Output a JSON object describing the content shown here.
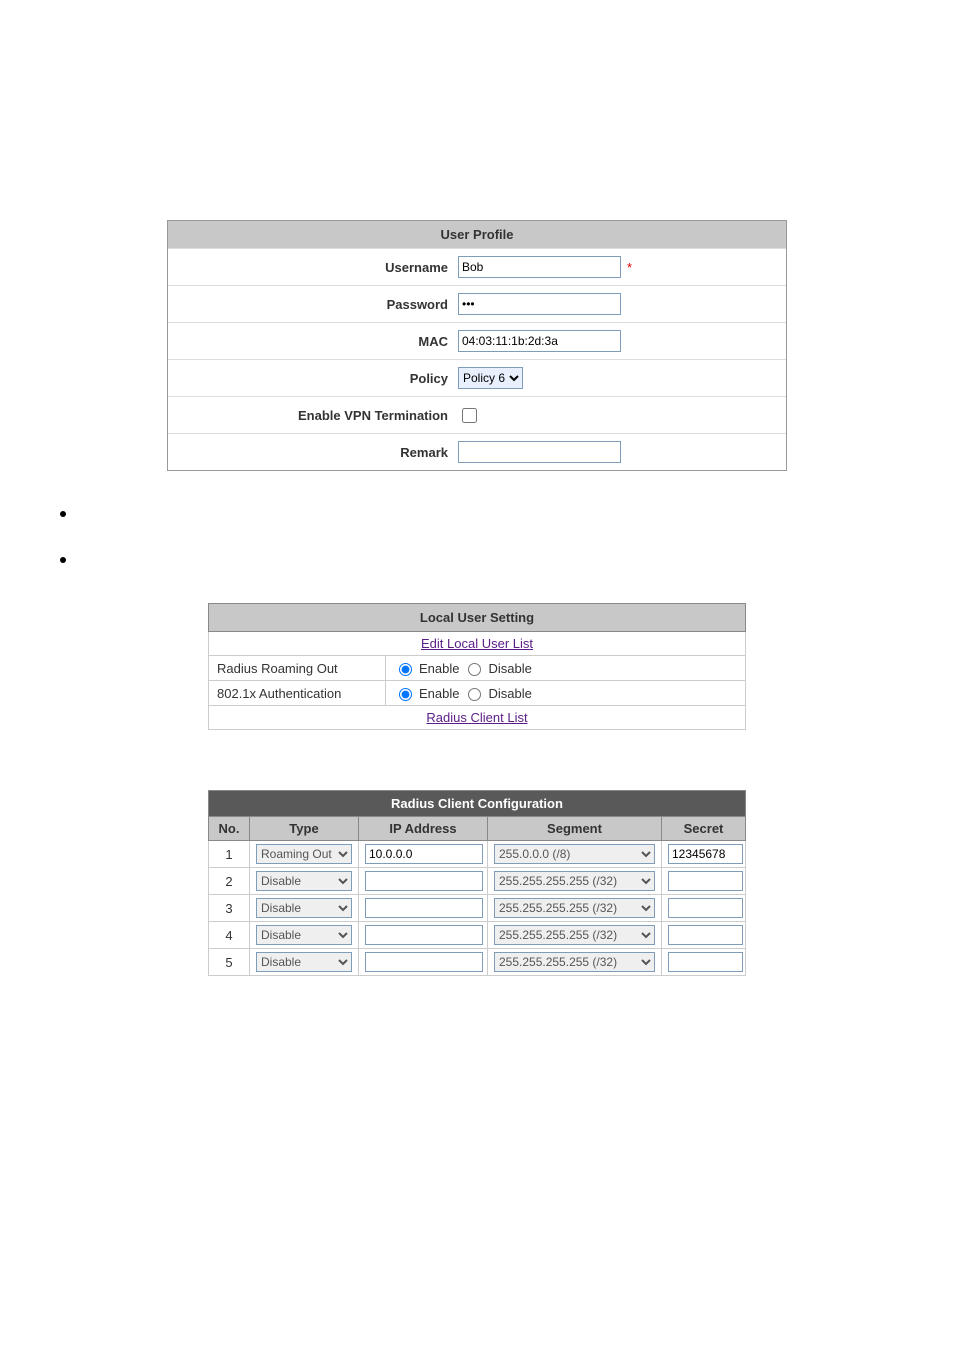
{
  "userProfile": {
    "title": "User Profile",
    "labels": {
      "username": "Username",
      "password": "Password",
      "mac": "MAC",
      "policy": "Policy",
      "enableVpn": "Enable VPN Termination",
      "remark": "Remark"
    },
    "values": {
      "username": "Bob",
      "password": "•••",
      "mac": "04:03:11:1b:2d:3a",
      "policySelected": "Policy 6",
      "enableVpn": false,
      "remark": ""
    },
    "requiredMarker": "*"
  },
  "localUserSetting": {
    "title": "Local User Setting",
    "editLink": "Edit Local User List",
    "rows": [
      {
        "label": "Radius Roaming Out",
        "selected": "Enable",
        "enableLabel": "Enable",
        "disableLabel": "Disable"
      },
      {
        "label": "802.1x Authentication",
        "selected": "Enable",
        "enableLabel": "Enable",
        "disableLabel": "Disable"
      }
    ],
    "radiusLink": "Radius Client List"
  },
  "radiusClientConfig": {
    "title": "Radius Client Configuration",
    "columns": {
      "no": "No.",
      "type": "Type",
      "ip": "IP Address",
      "segment": "Segment",
      "secret": "Secret"
    },
    "typeOptions": [
      "Roaming Out",
      "Disable"
    ],
    "segmentOptions": [
      "255.0.0.0 (/8)",
      "255.255.255.255 (/32)"
    ],
    "rows": [
      {
        "no": "1",
        "type": "Roaming Out",
        "ip": "10.0.0.0",
        "segment": "255.0.0.0 (/8)",
        "secret": "12345678"
      },
      {
        "no": "2",
        "type": "Disable",
        "ip": "",
        "segment": "255.255.255.255 (/32)",
        "secret": ""
      },
      {
        "no": "3",
        "type": "Disable",
        "ip": "",
        "segment": "255.255.255.255 (/32)",
        "secret": ""
      },
      {
        "no": "4",
        "type": "Disable",
        "ip": "",
        "segment": "255.255.255.255 (/32)",
        "secret": ""
      },
      {
        "no": "5",
        "type": "Disable",
        "ip": "",
        "segment": "255.255.255.255 (/32)",
        "secret": ""
      }
    ]
  }
}
